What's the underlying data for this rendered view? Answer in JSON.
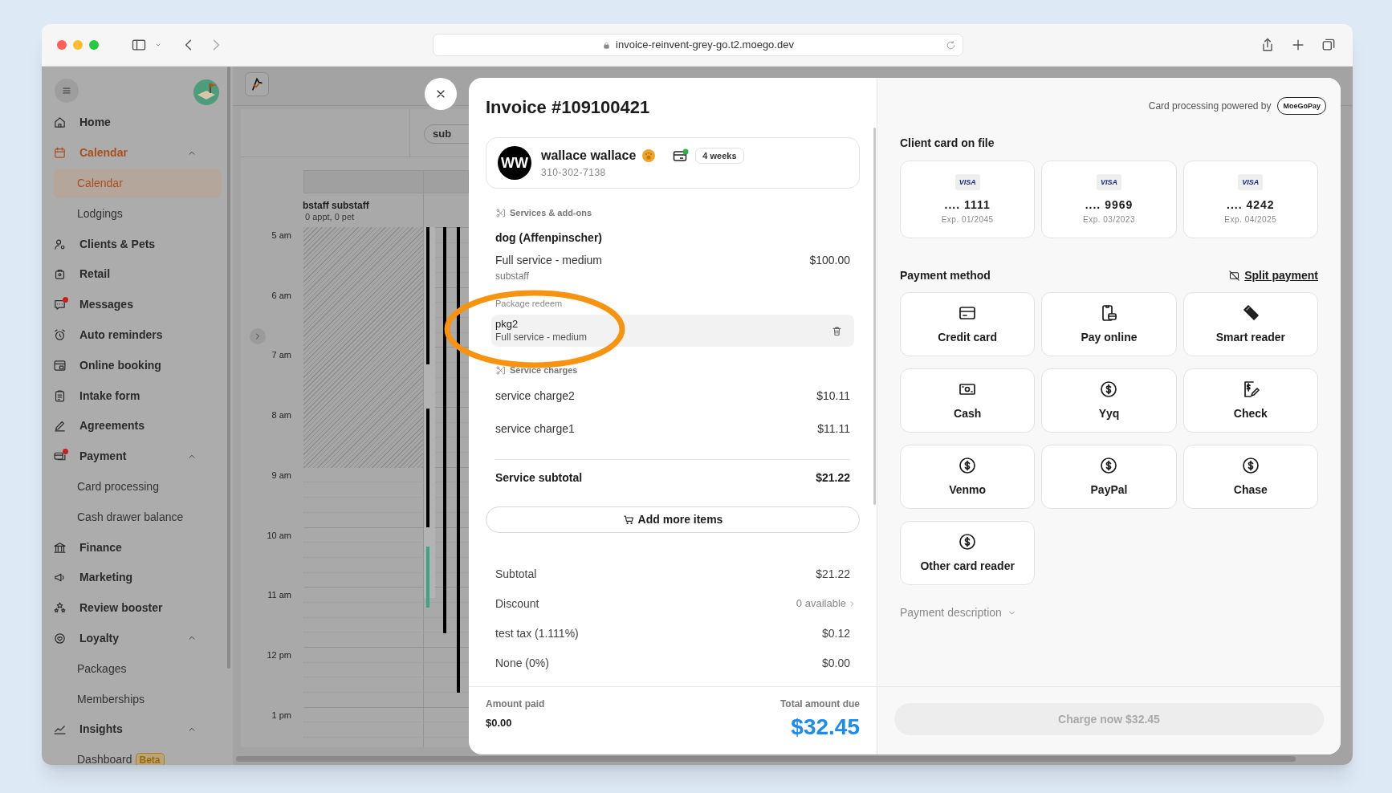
{
  "browser": {
    "url": "invoice-reinvent-grey-go.t2.moego.dev"
  },
  "sidebar": {
    "items": [
      {
        "label": "Home",
        "selected": false,
        "notification_dot": false
      },
      {
        "label": "Calendar",
        "selected": true,
        "notification_dot": false,
        "expanded": true,
        "children": [
          {
            "label": "Calendar",
            "selected": true
          },
          {
            "label": "Lodgings",
            "selected": false
          }
        ]
      },
      {
        "label": "Clients & Pets",
        "selected": false,
        "notification_dot": false
      },
      {
        "label": "Retail",
        "selected": false,
        "notification_dot": false
      },
      {
        "label": "Messages",
        "selected": false,
        "notification_dot": true
      },
      {
        "label": "Auto reminders",
        "selected": false,
        "notification_dot": false
      },
      {
        "label": "Online booking",
        "selected": false,
        "notification_dot": false
      },
      {
        "label": "Intake form",
        "selected": false,
        "notification_dot": false
      },
      {
        "label": "Agreements",
        "selected": false,
        "notification_dot": false
      },
      {
        "label": "Payment",
        "selected": false,
        "notification_dot": true,
        "expanded": true,
        "children": [
          {
            "label": "Card processing",
            "selected": false
          },
          {
            "label": "Cash drawer balance",
            "selected": false
          }
        ]
      },
      {
        "label": "Finance",
        "selected": false,
        "notification_dot": false
      },
      {
        "label": "Marketing",
        "selected": false,
        "notification_dot": false
      },
      {
        "label": "Review booster",
        "selected": false,
        "notification_dot": false
      },
      {
        "label": "Loyalty",
        "selected": false,
        "notification_dot": false,
        "expanded": true,
        "children": [
          {
            "label": "Packages",
            "selected": false
          },
          {
            "label": "Memberships",
            "selected": false
          }
        ]
      },
      {
        "label": "Insights",
        "selected": false,
        "notification_dot": false,
        "expanded": true,
        "children": [
          {
            "label": "Dashboard",
            "selected": false,
            "badge": "Beta"
          }
        ]
      }
    ]
  },
  "calendar": {
    "staff_filter": "sub",
    "staff": {
      "name": "bstaff substaff",
      "summary": "0 appt, 0 pet"
    },
    "hours": [
      "5 am",
      "6 am",
      "7 am",
      "8 am",
      "9 am",
      "10 am",
      "11 am",
      "12 pm",
      "1 pm"
    ]
  },
  "invoice": {
    "title": "Invoice #109100421",
    "client": {
      "initials": "WW",
      "name": "wallace wallace",
      "phone": "310-302-7138",
      "frequency": "4 weeks"
    },
    "services_label": "Services & add-ons",
    "pet": "dog (Affenpinscher)",
    "services": [
      {
        "name": "Full service - medium",
        "price": "$100.00",
        "staff": "substaff"
      }
    ],
    "package_label": "Package redeem",
    "package": {
      "name": "pkg2",
      "service": "Full service - medium"
    },
    "charges_label": "Service charges",
    "charges": [
      {
        "name": "service charge2",
        "amount": "$10.11"
      },
      {
        "name": "service charge1",
        "amount": "$11.11"
      }
    ],
    "service_subtotal": {
      "label": "Service subtotal",
      "amount": "$21.22"
    },
    "add_button": "Add more items",
    "summary": [
      {
        "label": "Subtotal",
        "value": "$21.22",
        "kind": "amount"
      },
      {
        "label": "Discount",
        "value": "0 available",
        "kind": "link"
      },
      {
        "label": "test tax (1.111%)",
        "value": "$0.12",
        "kind": "amount"
      },
      {
        "label": "None (0%)",
        "value": "$0.00",
        "kind": "amount"
      }
    ],
    "amount_paid": {
      "label": "Amount paid",
      "value": "$0.00"
    },
    "total_due": {
      "label": "Total amount due",
      "value": "$32.45"
    }
  },
  "payment": {
    "powered_by": "Card processing powered by",
    "provider_badge": "MoeGoPay",
    "cards_title": "Client card on file",
    "cards": [
      {
        "brand": "VISA",
        "number": ".... 1111",
        "expiry": "Exp. 01/2045",
        "selected": false
      },
      {
        "brand": "VISA",
        "number": ".... 9969",
        "expiry": "Exp. 03/2023",
        "selected": false
      },
      {
        "brand": "VISA",
        "number": ".... 4242",
        "expiry": "Exp. 04/2025",
        "selected": false
      }
    ],
    "methods_title": "Payment method",
    "split_link": "Split payment",
    "methods": [
      {
        "label": "Credit card",
        "selected": false
      },
      {
        "label": "Pay online",
        "selected": false
      },
      {
        "label": "Smart reader",
        "selected": false
      },
      {
        "label": "Cash",
        "selected": false
      },
      {
        "label": "Yyq",
        "selected": false
      },
      {
        "label": "Check",
        "selected": false
      },
      {
        "label": "Venmo",
        "selected": false
      },
      {
        "label": "PayPal",
        "selected": false
      },
      {
        "label": "Chase",
        "selected": false
      },
      {
        "label": "Other card reader",
        "selected": false
      }
    ],
    "description_toggle": "Payment description",
    "charge_button": {
      "label": "Charge now $32.45",
      "disabled": true
    }
  }
}
